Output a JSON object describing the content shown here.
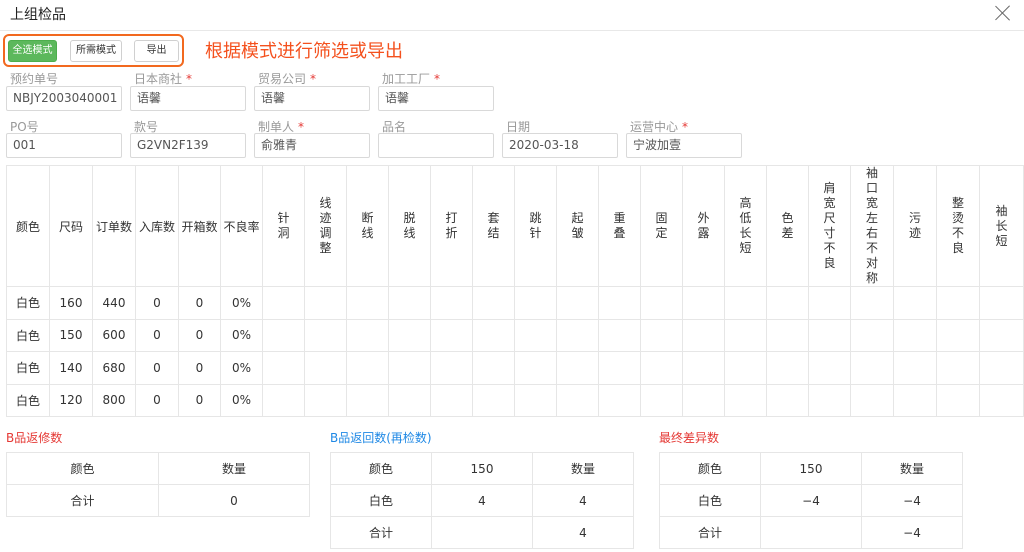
{
  "dialog": {
    "title": "上组检品"
  },
  "toolbar": {
    "select_all_label": "全选模式",
    "needed_mode_label": "所需模式",
    "export_label": "导出",
    "annotation": "根据模式进行筛选或导出"
  },
  "form": {
    "row1": [
      {
        "label": "预约单号",
        "required": false,
        "value": "NBJY2003040001"
      },
      {
        "label": "日本商社",
        "required": true,
        "value": "语馨"
      },
      {
        "label": "贸易公司",
        "required": true,
        "value": "语馨"
      },
      {
        "label": "加工工厂",
        "required": true,
        "value": "语馨"
      }
    ],
    "row2": [
      {
        "label": "PO号",
        "required": false,
        "value": "001"
      },
      {
        "label": "款号",
        "required": false,
        "value": "G2VN2F139"
      },
      {
        "label": "制单人",
        "required": true,
        "value": "俞雅青"
      },
      {
        "label": "品名",
        "required": false,
        "value": ""
      },
      {
        "label": "日期",
        "required": false,
        "value": "2020-03-18"
      },
      {
        "label": "运营中心",
        "required": true,
        "value": "宁波加壹"
      }
    ]
  },
  "inspection_table": {
    "headers": [
      "颜色",
      "尺码",
      "订单数",
      "入库数",
      "开箱数",
      "不良率"
    ],
    "defect_headers": [
      "针洞",
      "线迹调整",
      "断线",
      "脱线",
      "打折",
      "套结",
      "跳针",
      "起皱",
      "重叠",
      "固定",
      "外露",
      "高低长短",
      "色差",
      "肩宽尺寸不良",
      "袖口宽左右不对称",
      "污迹",
      "整烫不良",
      "袖长短"
    ],
    "rows": [
      {
        "color": "白色",
        "size": "160",
        "order": "440",
        "stock": "0",
        "open": "0",
        "rate": "0%"
      },
      {
        "color": "白色",
        "size": "150",
        "order": "600",
        "stock": "0",
        "open": "0",
        "rate": "0%"
      },
      {
        "color": "白色",
        "size": "140",
        "order": "680",
        "stock": "0",
        "open": "0",
        "rate": "0%"
      },
      {
        "color": "白色",
        "size": "120",
        "order": "800",
        "stock": "0",
        "open": "0",
        "rate": "0%"
      }
    ]
  },
  "b_repair": {
    "title": "B品返修数",
    "color": "#e53935",
    "headers": [
      "颜色",
      "数量"
    ],
    "total_label": "合计",
    "total_value": "0"
  },
  "b_return": {
    "title": "B品返回数(再检数)",
    "color": "#1e88e5",
    "headers": [
      "颜色",
      "150",
      "数量"
    ],
    "rows": [
      {
        "color": "白色",
        "size150": "4",
        "qty": "4"
      }
    ],
    "total_label": "合计",
    "total_value": "4"
  },
  "final_diff": {
    "title": "最终差异数",
    "color": "#e53935",
    "headers": [
      "颜色",
      "150",
      "数量"
    ],
    "rows": [
      {
        "color": "白色",
        "size150": "−4",
        "qty": "−4"
      }
    ],
    "total_label": "合计",
    "total_value": "−4"
  }
}
